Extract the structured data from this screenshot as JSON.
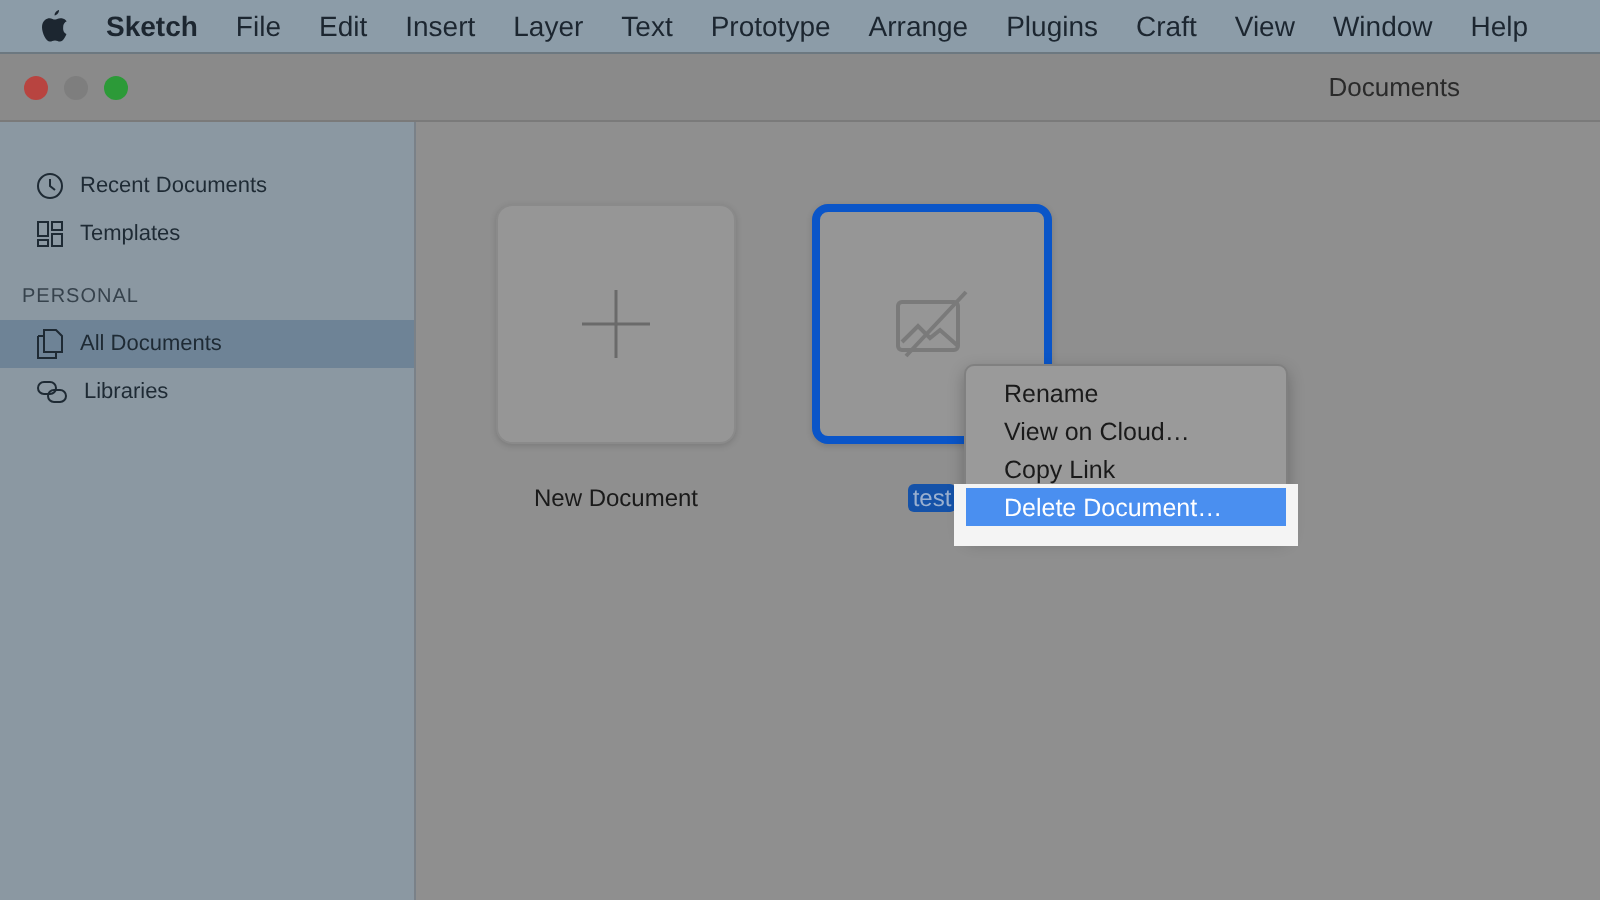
{
  "menu_bar": {
    "app": "Sketch",
    "items": [
      "File",
      "Edit",
      "Insert",
      "Layer",
      "Text",
      "Prototype",
      "Arrange",
      "Plugins",
      "Craft",
      "View",
      "Window",
      "Help"
    ]
  },
  "window": {
    "title": "Documents"
  },
  "sidebar": {
    "items": [
      {
        "label": "Recent Documents",
        "kind": "clock",
        "selected": false
      },
      {
        "label": "Templates",
        "kind": "grid",
        "selected": false
      }
    ],
    "sections": [
      {
        "heading": "PERSONAL",
        "items": [
          {
            "label": "All Documents",
            "kind": "docs",
            "selected": true
          },
          {
            "label": "Libraries",
            "kind": "links",
            "selected": false
          }
        ]
      }
    ]
  },
  "documents": [
    {
      "kind": "new",
      "name": "New Document",
      "selected": false
    },
    {
      "kind": "file",
      "name": "test",
      "selected": true
    }
  ],
  "context_menu": {
    "items": [
      {
        "label": "Rename",
        "selected": false
      },
      {
        "label": "View on Cloud…",
        "selected": false
      },
      {
        "label": "Copy Link",
        "selected": false
      },
      {
        "label": "Delete Document…",
        "selected": true
      }
    ]
  }
}
